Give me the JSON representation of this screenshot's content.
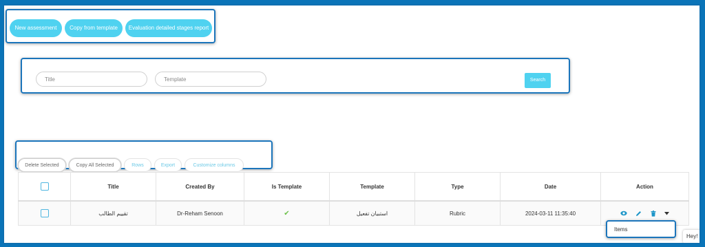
{
  "top_actions": {
    "new_assessment": "New assessment",
    "copy_from_template": "Copy from template",
    "evaluation_report": "Evaluation detailed stages report"
  },
  "filters": {
    "title_placeholder": "Title",
    "template_placeholder": "Template",
    "search_label": "Search"
  },
  "toolbar": {
    "delete_selected": "Delete Selected",
    "copy_all_selected": "Copy All Selected",
    "rows": "Rows",
    "export": "Export",
    "customize_columns": "Customize columns"
  },
  "table": {
    "headers": {
      "title": "Title",
      "created_by": "Created By",
      "is_template": "Is Template",
      "template": "Template",
      "type": "Type",
      "date": "Date",
      "action": "Action"
    },
    "rows": [
      {
        "title": "تقييم الطالب",
        "created_by": "Dr-Reham Senoon",
        "is_template": "✔",
        "template": "استبيان تفعيل",
        "type": "Rubric",
        "date": "2024-03-11 11:35:40"
      }
    ]
  },
  "action_menu": {
    "items_label": "Items"
  },
  "chat_widget": {
    "text": "Hey! I'm"
  },
  "colors": {
    "accent": "#4fd2f0",
    "frame": "#0a74b8",
    "highlight": "#1b75bb"
  },
  "icons": [
    "eye-icon",
    "pencil-icon",
    "trash-icon",
    "caret-down-icon",
    "check-icon"
  ]
}
